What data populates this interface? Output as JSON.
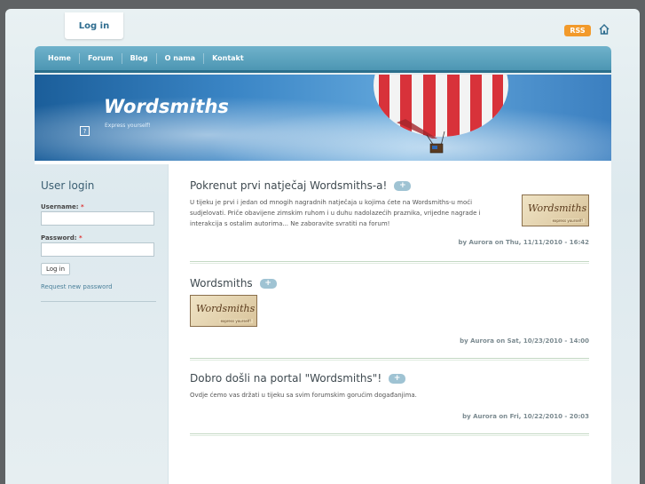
{
  "topbar": {
    "login_label": "Log in",
    "rss_label": "RSS"
  },
  "nav": {
    "items": [
      "Home",
      "Forum",
      "Blog",
      "O nama",
      "Kontakt"
    ]
  },
  "site": {
    "name": "Wordsmiths",
    "slogan": "Express yourself!"
  },
  "sidebar": {
    "title": "User login",
    "username_label": "Username:",
    "password_label": "Password:",
    "required_mark": "*",
    "username_value": "",
    "password_value": "",
    "login_button": "Log in",
    "request_password": "Request new password"
  },
  "logo_text": {
    "main": "Wordsmiths",
    "tag": "express yourself!"
  },
  "nodes": [
    {
      "title": "Pokrenut prvi natječaj Wordsmiths-a!",
      "comment_icon": "+",
      "body": "U tijeku je prvi i jedan od mnogih nagradnih natječaja u kojima ćete na Wordsmiths-u moći sudjelovati. Priče obavijene zimskim ruhom i u duhu nadolazećih praznika, vrijedne nagrade i interakcija s ostalim autorima... Ne zaboravite svratiti na forum!",
      "meta": "by Aurora on Thu, 11/11/2010 - 16:42"
    },
    {
      "title": "Wordsmiths",
      "comment_icon": "+",
      "body": "",
      "meta": "by Aurora on Sat, 10/23/2010 - 14:00"
    },
    {
      "title": "Dobro došli na portal \"Wordsmiths\"!",
      "comment_icon": "+",
      "body": "Ovdje ćemo vas držati u tijeku sa svim forumskim gorućim događanjima.",
      "meta": "by Aurora on Fri, 10/22/2010 - 20:03"
    }
  ],
  "colors": {
    "nav": "#4d96b3",
    "accent": "#2f6d8f",
    "rss": "#f29a2b"
  }
}
